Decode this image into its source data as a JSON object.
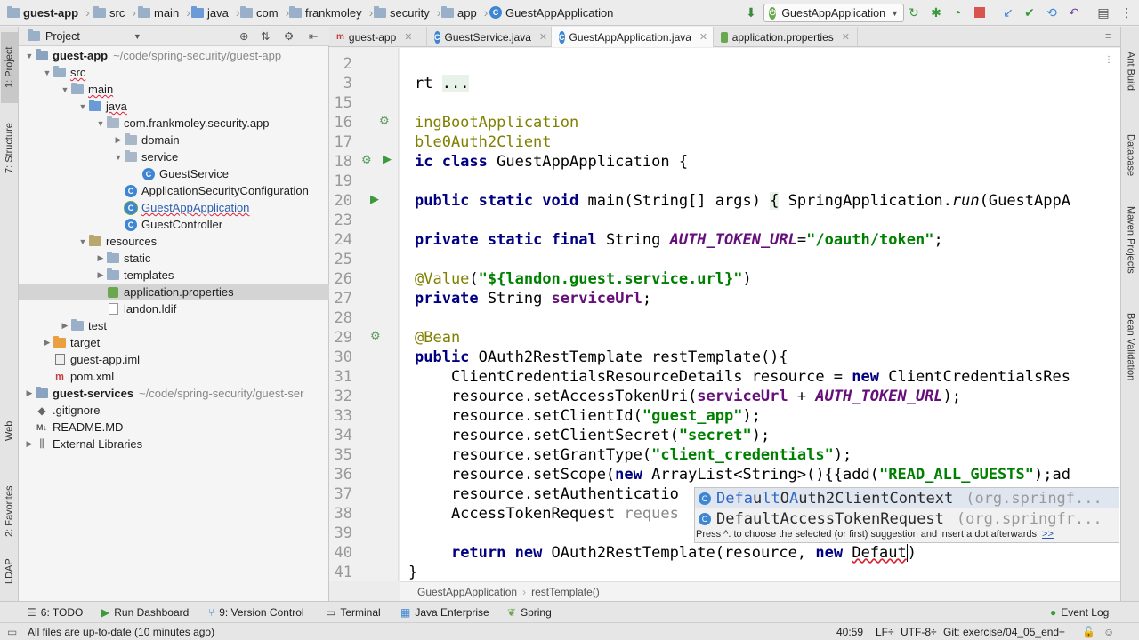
{
  "breadcrumb": {
    "items": [
      "guest-app",
      "src",
      "main",
      "java",
      "com",
      "frankmoley",
      "security",
      "app",
      "GuestAppApplication"
    ]
  },
  "run_config": {
    "label": "GuestAppApplication"
  },
  "left_strip": {
    "tabs": [
      "1: Project",
      "7: Structure",
      "Web",
      "2: Favorites",
      "LDAP"
    ]
  },
  "right_strip": {
    "tabs": [
      "Ant Build",
      "Database",
      "Maven Projects",
      "Bean Validation"
    ]
  },
  "project_panel": {
    "title": "Project",
    "tree": [
      {
        "label": "guest-app",
        "path": "~/code/spring-security/guest-app",
        "bold": true,
        "indent": 0,
        "arrow": "down",
        "icon": "module-folder-icon"
      },
      {
        "label": "src",
        "indent": 1,
        "arrow": "down",
        "icon": "folder-icon"
      },
      {
        "label": "main",
        "indent": 2,
        "arrow": "down",
        "icon": "folder-icon"
      },
      {
        "label": "java",
        "indent": 3,
        "arrow": "down",
        "icon": "source-folder-icon"
      },
      {
        "label": "com.frankmoley.security.app",
        "indent": 4,
        "arrow": "down",
        "icon": "package-icon"
      },
      {
        "label": "domain",
        "indent": 5,
        "arrow": "right",
        "icon": "package-icon"
      },
      {
        "label": "service",
        "indent": 5,
        "arrow": "down",
        "icon": "package-icon"
      },
      {
        "label": "GuestService",
        "indent": 6,
        "arrow": "",
        "icon": "class-icon"
      },
      {
        "label": "ApplicationSecurityConfiguration",
        "indent": 5,
        "arrow": "",
        "icon": "class-icon"
      },
      {
        "label": "GuestAppApplication",
        "indent": 5,
        "arrow": "",
        "icon": "spring-class-icon"
      },
      {
        "label": "GuestController",
        "indent": 5,
        "arrow": "",
        "icon": "class-icon"
      },
      {
        "label": "resources",
        "indent": 3,
        "arrow": "down",
        "icon": "resources-folder-icon"
      },
      {
        "label": "static",
        "indent": 4,
        "arrow": "right",
        "icon": "folder-icon"
      },
      {
        "label": "templates",
        "indent": 4,
        "arrow": "right",
        "icon": "folder-icon"
      },
      {
        "label": "application.properties",
        "indent": 4,
        "arrow": "",
        "icon": "spring-properties-icon",
        "selected": true
      },
      {
        "label": "landon.ldif",
        "indent": 4,
        "arrow": "",
        "icon": "file-icon"
      },
      {
        "label": "test",
        "indent": 2,
        "arrow": "right",
        "icon": "folder-icon"
      },
      {
        "label": "target",
        "indent": 1,
        "arrow": "right",
        "icon": "excluded-folder-icon"
      },
      {
        "label": "guest-app.iml",
        "indent": 1,
        "arrow": "",
        "icon": "iml-file-icon"
      },
      {
        "label": "pom.xml",
        "indent": 1,
        "arrow": "",
        "icon": "maven-file-icon"
      },
      {
        "label": "guest-services",
        "path": "~/code/spring-security/guest-ser",
        "bold": true,
        "indent": 0,
        "arrow": "right",
        "icon": "module-folder-icon"
      },
      {
        "label": ".gitignore",
        "indent": 0,
        "arrow": "",
        "icon": "gitignore-file-icon"
      },
      {
        "label": "README.MD",
        "indent": 0,
        "arrow": "",
        "icon": "markdown-file-icon"
      },
      {
        "label": "External Libraries",
        "indent": 0,
        "arrow": "right",
        "icon": "libraries-icon"
      }
    ]
  },
  "editor_tabs": [
    {
      "label": "guest-app",
      "icon": "maven-file-icon",
      "active": false
    },
    {
      "label": "GuestService.java",
      "icon": "class-icon",
      "active": false
    },
    {
      "label": "GuestAppApplication.java",
      "icon": "class-icon",
      "active": true
    },
    {
      "label": "application.properties",
      "icon": "spring-properties-icon",
      "active": false
    }
  ],
  "editor": {
    "line_numbers": [
      "2",
      "3",
      "15",
      "16",
      "17",
      "18",
      "19",
      "20",
      "23",
      "24",
      "25",
      "26",
      "27",
      "28",
      "29",
      "30",
      "31",
      "32",
      "33",
      "34",
      "35",
      "36",
      "37",
      "38",
      "39",
      "40",
      "41"
    ],
    "breadcrumb": [
      "GuestAppApplication",
      "restTemplate()"
    ]
  },
  "completion": {
    "items": [
      {
        "prefix": "Defa",
        "match1": "u",
        "mid": "lt",
        "match2": "O",
        "rest": "A",
        "match3": "u",
        "tail": "th2ClientContext",
        "pkg": "(org.springf..."
      },
      {
        "name": "DefaultAccessTokenRequest",
        "pkg": "(org.springfr..."
      }
    ],
    "hint": "Press ^. to choose the selected (or first) suggestion and insert a dot afterwards",
    "hint_link": ">>"
  },
  "tool_windows": [
    {
      "label": "6: TODO",
      "icon": "todo-icon"
    },
    {
      "label": "Run Dashboard",
      "icon": "run-icon"
    },
    {
      "label": "9: Version Control",
      "icon": "vcs-icon"
    },
    {
      "label": "Terminal",
      "icon": "terminal-icon"
    },
    {
      "label": "Java Enterprise",
      "icon": "java-enterprise-icon"
    },
    {
      "label": "Spring",
      "icon": "spring-icon"
    },
    {
      "label": "Event Log",
      "icon": "event-log-icon"
    }
  ],
  "status_bar": {
    "message": "All files are up-to-date (10 minutes ago)",
    "position": "40:59",
    "line_sep": "LF÷",
    "encoding": "UTF-8÷",
    "git": "Git: exercise/04_05_end÷"
  },
  "colors": {
    "keyword": "#000080",
    "string": "#008000",
    "annotation": "#808000",
    "field": "#660e7a",
    "accent": "#3e86d2"
  }
}
